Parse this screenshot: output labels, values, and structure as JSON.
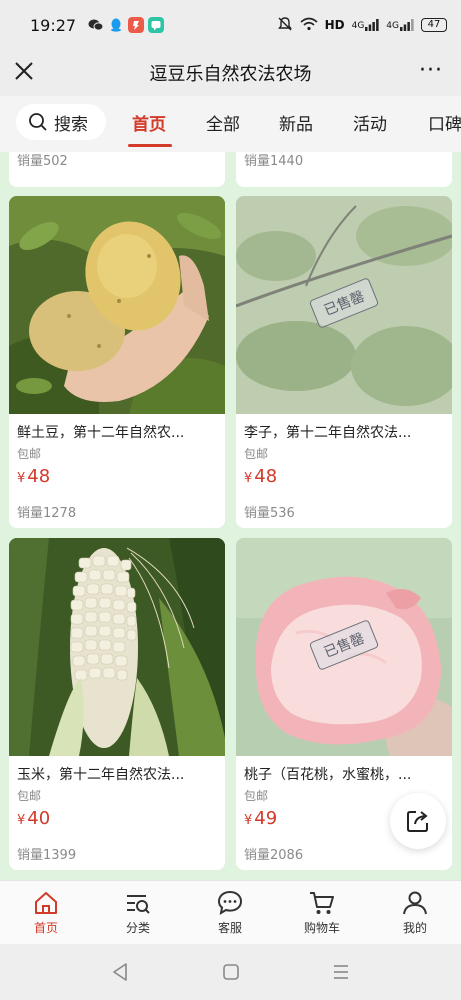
{
  "status_bar": {
    "time": "19:27",
    "hd_label": "HD",
    "signal_1": "4G",
    "signal_2": "4G",
    "battery": "47"
  },
  "title_bar": {
    "title": "逗豆乐自然农法农场",
    "more": "···"
  },
  "tabs": {
    "search_label": "搜索",
    "items": [
      {
        "label": "首页",
        "active": true
      },
      {
        "label": "全部"
      },
      {
        "label": "新品"
      },
      {
        "label": "活动"
      },
      {
        "label": "口碑"
      }
    ]
  },
  "partial_cards": [
    {
      "sales": "销量502"
    },
    {
      "sales": "销量1440"
    }
  ],
  "products": [
    {
      "name": "鲜土豆，第十二年自然农...",
      "shipping": "包邮",
      "currency": "¥",
      "price": "48",
      "sales": "销量1278",
      "sold_out": false
    },
    {
      "name": "李子，第十二年自然农法...",
      "shipping": "包邮",
      "currency": "¥",
      "price": "48",
      "sales": "销量536",
      "sold_out": true,
      "stamp": "已售罄"
    },
    {
      "name": "玉米，第十二年自然农法...",
      "shipping": "包邮",
      "currency": "¥",
      "price": "40",
      "sales": "销量1399",
      "sold_out": false
    },
    {
      "name": "桃子（百花桃，水蜜桃，...",
      "shipping": "包邮",
      "currency": "¥",
      "price": "49",
      "sales": "销量2086",
      "sold_out": true,
      "stamp": "已售罄"
    }
  ],
  "bottom_nav": {
    "items": [
      {
        "label": "首页",
        "icon": "home-icon",
        "active": true
      },
      {
        "label": "分类",
        "icon": "category-search-icon"
      },
      {
        "label": "客服",
        "icon": "chat-icon"
      },
      {
        "label": "购物车",
        "icon": "cart-icon"
      },
      {
        "label": "我的",
        "icon": "user-icon"
      }
    ]
  },
  "colors": {
    "accent": "#d23a2a",
    "page_bg": "#dff3de",
    "bar_bg": "#ededed"
  }
}
